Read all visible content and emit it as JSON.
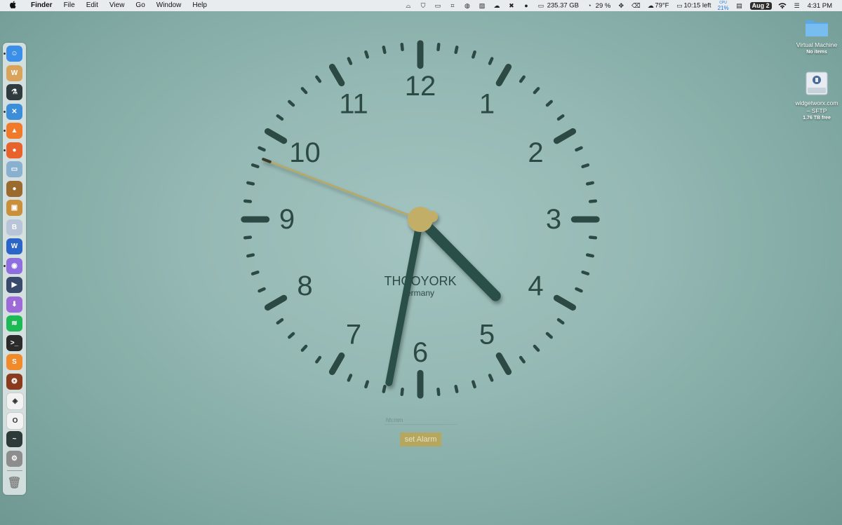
{
  "menubar": {
    "app_name": "Finder",
    "items": [
      "File",
      "Edit",
      "View",
      "Go",
      "Window",
      "Help"
    ],
    "status": {
      "disk": "235.37 GB",
      "battery_percent": "29 %",
      "weather": "79°F",
      "battery_left": "10:15 left",
      "cpu_label": "CPU",
      "cpu_value": "21%",
      "date": "Aug 2",
      "time": "4:31 PM"
    },
    "status_icons": [
      "screen-mirror-icon",
      "shield-icon",
      "display-icon",
      "screenshot-icon",
      "globe-icon",
      "photo-icon",
      "cloud-sync-icon",
      "close-circle-icon",
      "droplet-icon",
      "drive-icon",
      "progress-icon",
      "move-icon",
      "trash-icon",
      "cloud-icon",
      "battery-icon",
      "clipboard-icon",
      "wifi-icon",
      "control-center-icon"
    ]
  },
  "desktop": {
    "items": [
      {
        "name": "Virtual Machine",
        "sub": "No items",
        "icon": "folder-icon"
      },
      {
        "name": "widgetworx.com – SFTP",
        "sub": "1.76 TB free",
        "icon": "network-drive-icon"
      }
    ]
  },
  "dock": {
    "apps": [
      {
        "name": "finder",
        "color": "#3b8fe8",
        "glyph": "☺",
        "running": true
      },
      {
        "name": "word-doc",
        "color": "#d9a35c",
        "glyph": "W",
        "running": false
      },
      {
        "name": "lab",
        "color": "#2f3b3e",
        "glyph": "⚗",
        "running": false
      },
      {
        "name": "xcode-tools",
        "color": "#3c8ed8",
        "glyph": "✕",
        "running": true
      },
      {
        "name": "brave",
        "color": "#f07a2a",
        "glyph": "▲",
        "running": true
      },
      {
        "name": "firefox",
        "color": "#e8622c",
        "glyph": "●",
        "running": true
      },
      {
        "name": "preview",
        "color": "#8ab0d0",
        "glyph": "▭",
        "running": false
      },
      {
        "name": "cyberduck",
        "color": "#9b6a2d",
        "glyph": "●",
        "running": false
      },
      {
        "name": "image-app",
        "color": "#c98f3a",
        "glyph": "▣",
        "running": false
      },
      {
        "name": "bbedit",
        "color": "#b8c4d8",
        "glyph": "B",
        "running": false
      },
      {
        "name": "microsoft-word",
        "color": "#2b65c8",
        "glyph": "W",
        "running": false
      },
      {
        "name": "nova",
        "color": "#8f6ee0",
        "glyph": "◉",
        "running": true
      },
      {
        "name": "infuse",
        "color": "#3a4a6a",
        "glyph": "▶",
        "running": false
      },
      {
        "name": "downie",
        "color": "#9d6ad8",
        "glyph": "⬇",
        "running": false
      },
      {
        "name": "spotify",
        "color": "#1db954",
        "glyph": "≋",
        "running": false
      },
      {
        "name": "terminal",
        "color": "#2b2b2b",
        "glyph": ">_",
        "running": false
      },
      {
        "name": "setapp",
        "color": "#f08a2a",
        "glyph": "S",
        "running": false
      },
      {
        "name": "coffee",
        "color": "#8a3b1e",
        "glyph": "❂",
        "running": false
      },
      {
        "name": "layers",
        "color": "#f2f2f2",
        "glyph": "◈",
        "running": false
      },
      {
        "name": "opera",
        "color": "#f2f2f2",
        "glyph": "O",
        "running": false
      },
      {
        "name": "activity-monitor",
        "color": "#2e3a38",
        "glyph": "~",
        "running": false
      },
      {
        "name": "system-preferences",
        "color": "#8d8d8d",
        "glyph": "⚙",
        "running": false
      }
    ],
    "trash": {
      "name": "trash",
      "glyph": "🗑"
    }
  },
  "clock": {
    "numerals": [
      "12",
      "1",
      "2",
      "3",
      "4",
      "5",
      "6",
      "7",
      "8",
      "9",
      "10",
      "11"
    ],
    "city": "THOOYORK",
    "country": "ermany",
    "time": {
      "hour": 4,
      "minute": 31,
      "second": 48.5
    },
    "colors": {
      "face": "#2c4944",
      "hands": "#2a4f49",
      "second_hand": "#b9a863",
      "hub": "#c2ae66"
    }
  },
  "alarm": {
    "placeholder": "hh:mm",
    "button_label": "set Alarm"
  }
}
